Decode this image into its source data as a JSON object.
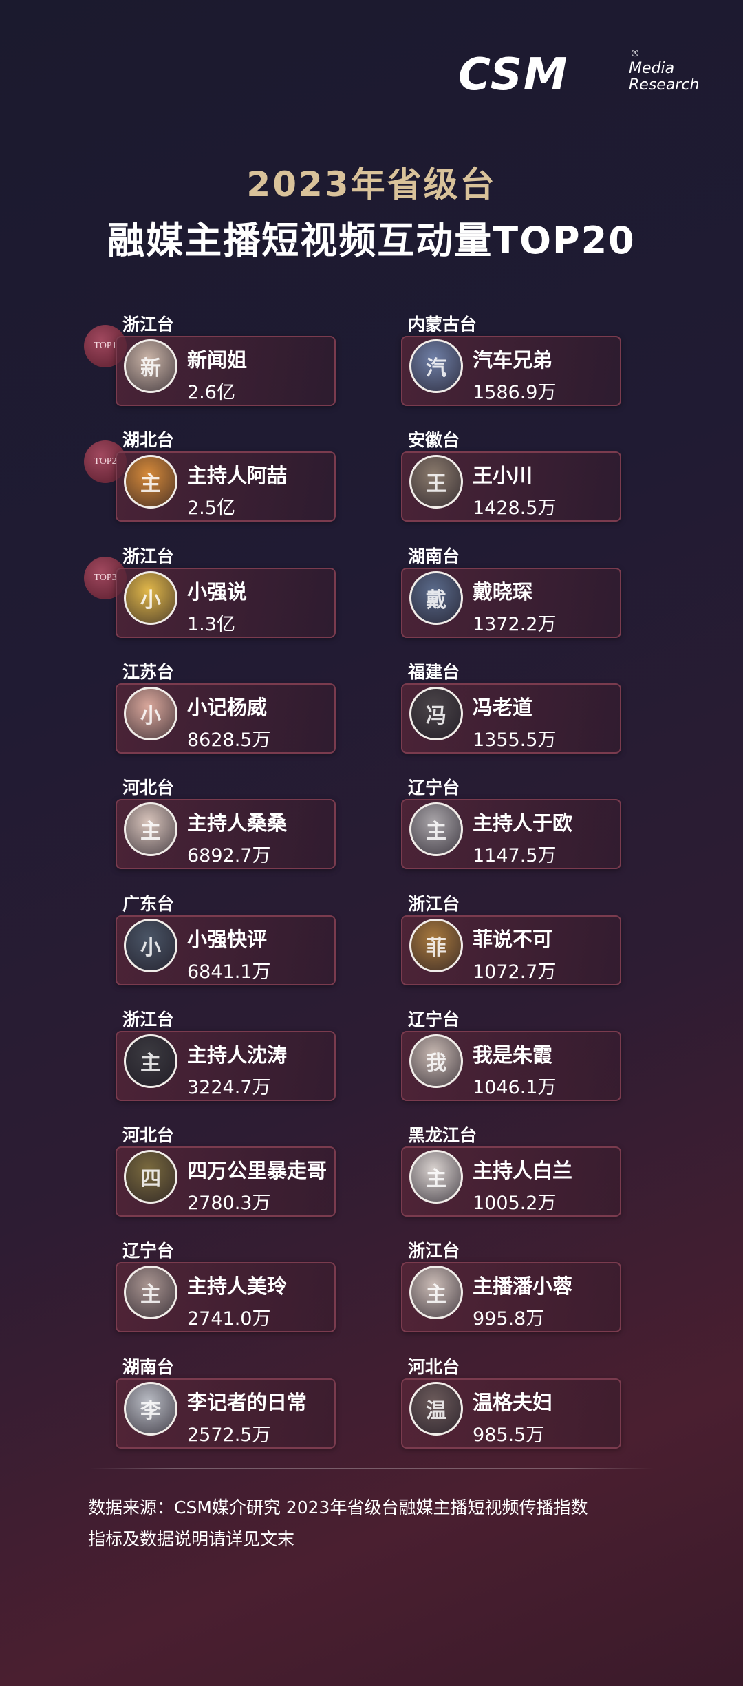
{
  "logo": {
    "brand": "CSM",
    "sub": "Media\nResearch",
    "registered": "®"
  },
  "title_line1": "2023年省级台",
  "title_line2": "融媒主播短视频互动量TOP20",
  "left_column": [
    {
      "station": "浙江台",
      "name": "新闻姐",
      "value": "2.6亿",
      "badge": "TOP1",
      "avatar_color": "#c9b3a6"
    },
    {
      "station": "湖北台",
      "name": "主持人阿喆",
      "value": "2.5亿",
      "badge": "TOP2",
      "avatar_color": "#d68a3a"
    },
    {
      "station": "浙江台",
      "name": "小强说",
      "value": "1.3亿",
      "badge": "TOP3",
      "avatar_color": "#e2b84a"
    },
    {
      "station": "江苏台",
      "name": "小记杨威",
      "value": "8628.5万",
      "badge": "",
      "avatar_color": "#d9a79b"
    },
    {
      "station": "河北台",
      "name": "主持人桑桑",
      "value": "6892.7万",
      "badge": "",
      "avatar_color": "#d8c4bb"
    },
    {
      "station": "广东台",
      "name": "小强快评",
      "value": "6841.1万",
      "badge": "",
      "avatar_color": "#4a5566"
    },
    {
      "station": "浙江台",
      "name": "主持人沈涛",
      "value": "3224.7万",
      "badge": "",
      "avatar_color": "#3b3a40"
    },
    {
      "station": "河北台",
      "name": "四万公里暴走哥",
      "value": "2780.3万",
      "badge": "",
      "avatar_color": "#7a6a3e"
    },
    {
      "station": "辽宁台",
      "name": "主持人美玲",
      "value": "2741.0万",
      "badge": "",
      "avatar_color": "#a89490"
    },
    {
      "station": "湖南台",
      "name": "李记者的日常",
      "value": "2572.5万",
      "badge": "",
      "avatar_color": "#b9bcc4"
    }
  ],
  "right_column": [
    {
      "station": "内蒙古台",
      "name": "汽车兄弟",
      "value": "1586.9万",
      "badge": "",
      "avatar_color": "#6f7fa6"
    },
    {
      "station": "安徽台",
      "name": "王小川",
      "value": "1428.5万",
      "badge": "",
      "avatar_color": "#8a7a6c"
    },
    {
      "station": "湖南台",
      "name": "戴晓琛",
      "value": "1372.2万",
      "badge": "",
      "avatar_color": "#5a6a8a"
    },
    {
      "station": "福建台",
      "name": "冯老道",
      "value": "1355.5万",
      "badge": "",
      "avatar_color": "#4a4448"
    },
    {
      "station": "辽宁台",
      "name": "主持人于欧",
      "value": "1147.5万",
      "badge": "",
      "avatar_color": "#a8a4a8"
    },
    {
      "station": "浙江台",
      "name": "菲说不可",
      "value": "1072.7万",
      "badge": "",
      "avatar_color": "#a8793e"
    },
    {
      "station": "辽宁台",
      "name": "我是朱霞",
      "value": "1046.1万",
      "badge": "",
      "avatar_color": "#c6b7b0"
    },
    {
      "station": "黑龙江台",
      "name": "主持人白兰",
      "value": "1005.2万",
      "badge": "",
      "avatar_color": "#d9d2cf"
    },
    {
      "station": "浙江台",
      "name": "主播潘小蓉",
      "value": "995.8万",
      "badge": "",
      "avatar_color": "#cbbcb6"
    },
    {
      "station": "河北台",
      "name": "温格夫妇",
      "value": "985.5万",
      "badge": "",
      "avatar_color": "#6b5a5a"
    }
  ],
  "footer_line1": "数据来源：CSM媒介研究 2023年省级台融媒主播短视频传播指数",
  "footer_line2": "指标及数据说明请详见文末"
}
